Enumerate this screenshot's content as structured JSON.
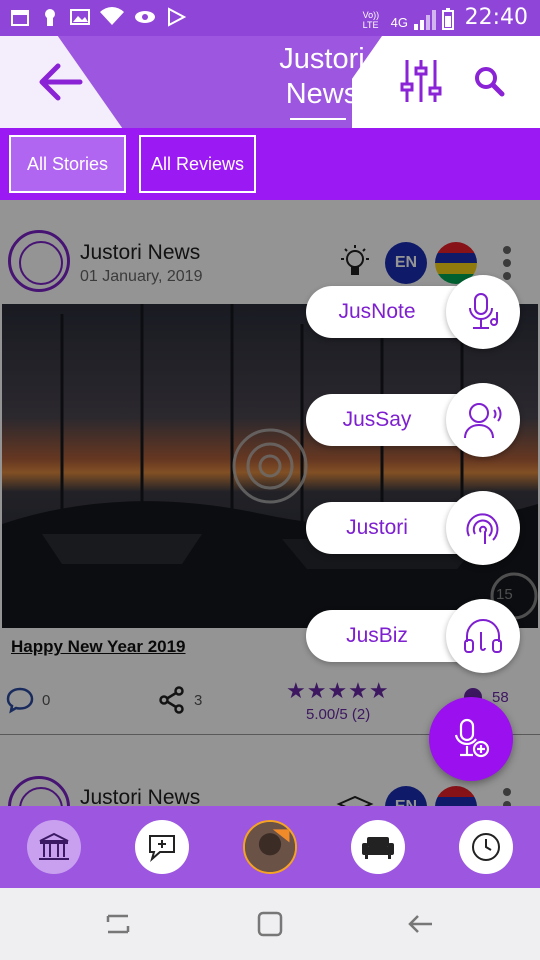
{
  "statusbar": {
    "time": "22:40",
    "network": "4G",
    "volte": "Vo)) LTE",
    "icons": [
      "calendar-icon",
      "keyhole-icon",
      "image-icon",
      "wifi-icon",
      "eye-icon",
      "play-store-icon"
    ]
  },
  "header": {
    "title_line1": "Justori",
    "title_line2": "News",
    "icons": [
      "back-arrow-icon",
      "equalizer-icon",
      "search-icon"
    ]
  },
  "tabs": [
    {
      "label": "All Stories",
      "active": true
    },
    {
      "label": "All Reviews",
      "active": false
    }
  ],
  "feed": [
    {
      "author": "Justori News",
      "date": "01 January, 2019",
      "language": "EN",
      "title": "Happy New Year 2019",
      "comments": "0",
      "shares": "3",
      "rating_text": "5.00/5 (2)",
      "stars": 5,
      "likes": "58",
      "audio_length": "15"
    },
    {
      "author": "Justori News",
      "language": "EN"
    }
  ],
  "fab_menu": [
    {
      "label": "JusNote",
      "icon": "microphone-note-icon"
    },
    {
      "label": "JusSay",
      "icon": "speaking-person-icon"
    },
    {
      "label": "Justori",
      "icon": "justori-logo-icon"
    },
    {
      "label": "JusBiz",
      "icon": "headset-icon"
    }
  ],
  "bottom_nav": [
    "museum-icon",
    "chat-add-icon",
    "profile-avatar",
    "sofa-icon",
    "clock-icon"
  ],
  "colors": {
    "primary": "#9c56e0",
    "accent": "#9a10ef",
    "tab_bar": "#9b19f2",
    "brand_text": "#7e1fd0"
  }
}
